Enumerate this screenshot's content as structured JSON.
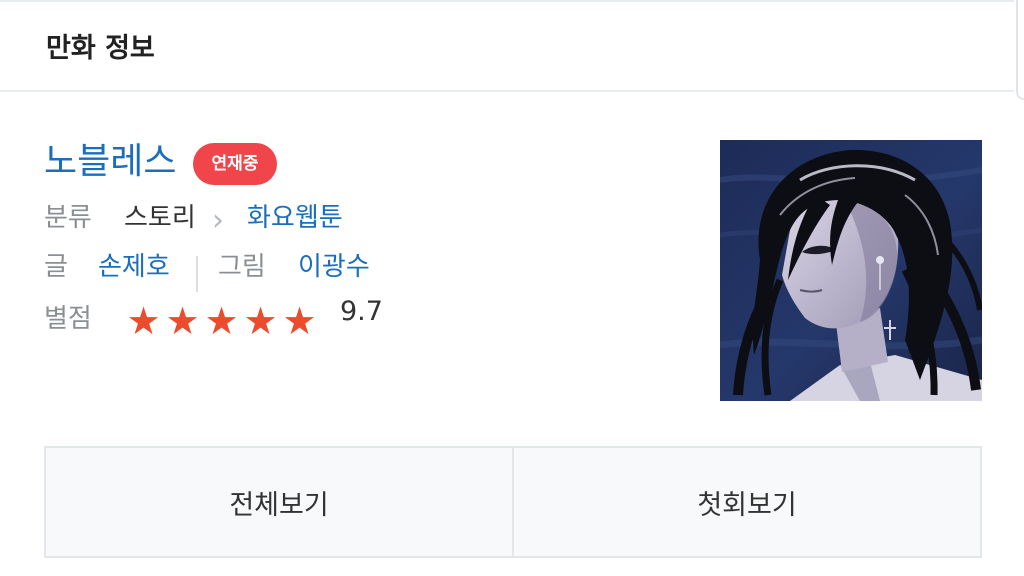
{
  "header": {
    "title": "만화 정보"
  },
  "comic": {
    "title": "노블레스",
    "status_badge": "연재중",
    "genre_label": "분류",
    "genre": "스토리",
    "day": "화요웹툰",
    "writer_label": "글",
    "writer": "손제호",
    "artist_label": "그림",
    "artist": "이광수",
    "rating_label": "별점",
    "rating": "9.7",
    "stars_filled": 5,
    "stars_total": 5
  },
  "colors": {
    "link": "#1a6ebd",
    "badge": "#f0464b",
    "star": "#ec4b2e"
  },
  "icons": {
    "chevron": "chevron-right-icon",
    "star": "star-icon"
  },
  "actions": {
    "view_all": "전체보기",
    "view_first": "첫회보기"
  }
}
